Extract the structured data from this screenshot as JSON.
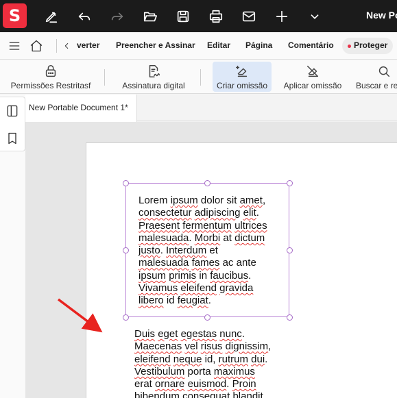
{
  "app": {
    "logo_letter": "S",
    "title": "New Po",
    "accent": "#ee2e3e"
  },
  "toolbar_icons": [
    "pen-icon",
    "undo-icon",
    "redo-icon",
    "open-folder-icon",
    "save-icon",
    "print-icon",
    "mail-icon",
    "add-icon",
    "chevron-down-icon"
  ],
  "menubar": {
    "items": [
      "verter",
      "Preencher e Assinar",
      "Editar",
      "Página",
      "Comentário"
    ],
    "active": "Proteger",
    "active_dot_color": "#e8334a"
  },
  "ribbon": {
    "buttons": [
      {
        "label": "Permissões Restritasf",
        "icon": "lock-icon"
      },
      {
        "label": "Assinatura digital",
        "icon": "signature-icon"
      },
      {
        "label": "Criar omissão",
        "icon": "create-redaction-icon"
      },
      {
        "label": "Aplicar omissão",
        "icon": "apply-redaction-icon"
      },
      {
        "label": "Buscar e re",
        "icon": "search-icon"
      }
    ],
    "active_index": 2
  },
  "tabs": {
    "document": "New Portable Document 1*"
  },
  "document": {
    "box_lines": [
      "Lorem ipsum dolor sit amet,",
      "consectetur adipiscing elit.",
      "Praesent fermentum ultrices",
      "malesuada. Morbi at dictum",
      "justo. Interdum et",
      "malesuada fames ac ante",
      "ipsum primis in faucibus.",
      "Vivamus eleifend gravida",
      "libero id feugiat."
    ],
    "body_lines": [
      "Duis eget egestas nunc.",
      "Maecenas vel risus dignissim,",
      "eleifend neque id, rutrum dui.",
      "Vestibulum porta maximus",
      "erat ornare euismod. Proin",
      "bibendum consequat blandit."
    ]
  }
}
